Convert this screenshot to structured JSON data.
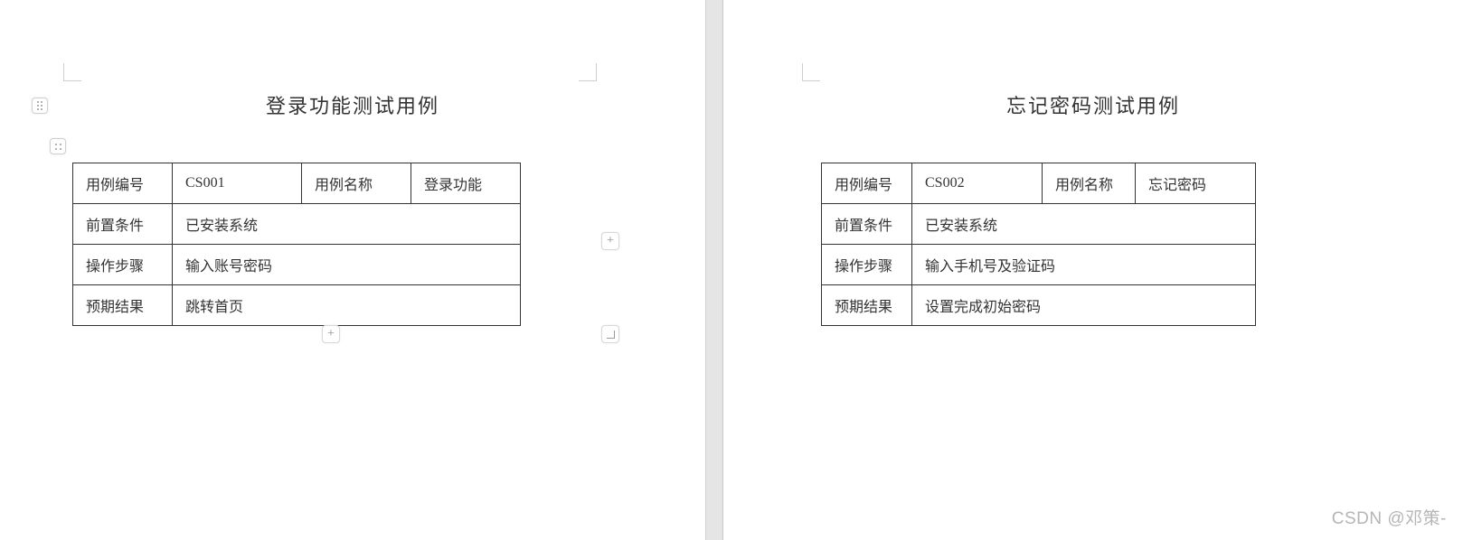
{
  "pages": {
    "left": {
      "title": "登录功能测试用例",
      "rows": {
        "id_label": "用例编号",
        "id_value": "CS001",
        "name_label": "用例名称",
        "name_value": "登录功能",
        "pre_label": "前置条件",
        "pre_value": "已安装系统",
        "step_label": "操作步骤",
        "step_value": "输入账号密码",
        "expect_label": "预期结果",
        "expect_value": "跳转首页"
      }
    },
    "right": {
      "title": "忘记密码测试用例",
      "rows": {
        "id_label": "用例编号",
        "id_value": "CS002",
        "name_label": "用例名称",
        "name_value": "忘记密码",
        "pre_label": "前置条件",
        "pre_value": "已安装系统",
        "step_label": "操作步骤",
        "step_value": "输入手机号及验证码",
        "expect_label": "预期结果",
        "expect_value": "设置完成初始密码"
      }
    }
  },
  "controls": {
    "add_col": "+",
    "add_row": "+"
  },
  "watermark": "CSDN @邓策-"
}
